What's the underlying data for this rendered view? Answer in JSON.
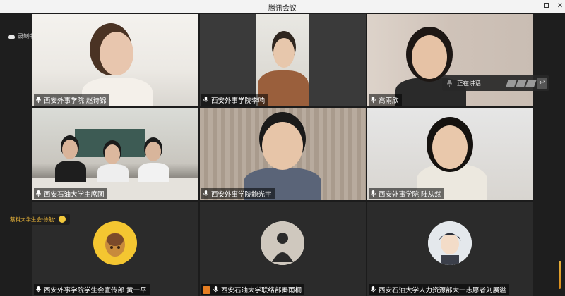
{
  "window": {
    "title": "腾讯会议"
  },
  "sidebar": {
    "recording_label": "录制中"
  },
  "speaking": {
    "label": "正在讲话:"
  },
  "chat": {
    "message": "蔡料大学生会·徐航:"
  },
  "tiles": [
    {
      "name": "西安外事学院 赵诗锦",
      "mic": "on"
    },
    {
      "name": "西安外事学院李响",
      "mic": "on"
    },
    {
      "name": "高雨欣",
      "mic": "on"
    },
    {
      "name": "西安石油大学主席团",
      "mic": "on"
    },
    {
      "name": "西安外事学院鲍光宇",
      "mic": "on"
    },
    {
      "name": "西安外事学院   陆从然",
      "mic": "on"
    },
    {
      "name": "西安外事学院学生会宣传部 黄一平",
      "mic": "on",
      "avatar": "sweet-potato-icon"
    },
    {
      "name": "西安石油大学联络部秦雨桐",
      "mic": "on",
      "avatar": "silhouette-icon",
      "badge": "host-badge"
    },
    {
      "name": "西安石油大学人力资源部大一志愿者刘展溢",
      "mic": "on",
      "avatar": "anime-boy-icon"
    }
  ],
  "colors": {
    "accent": "#f0b93a",
    "badge": "#e67e22"
  }
}
